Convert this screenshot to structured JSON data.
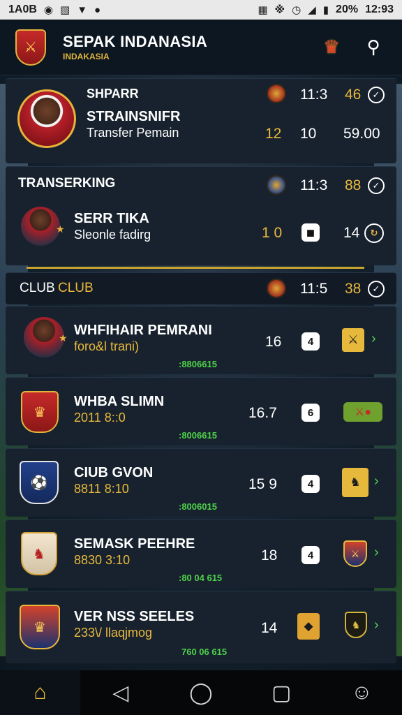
{
  "status_bar": {
    "left_text": "1A0B",
    "percent": "20%",
    "time": "12:93"
  },
  "header": {
    "title": "SEPAK INDANASIA",
    "subtitle": "INDAKASIA"
  },
  "featured": {
    "label": "SHPARR",
    "time": "11:3",
    "score": "46",
    "name": "STRAINSNIFR",
    "sub": "Transfer Pemain",
    "num_a": "12",
    "num_b": "10",
    "num_c": "59.00"
  },
  "transfer_section": {
    "title": "TRANSERKING",
    "time": "11:3",
    "score": "88",
    "player_name": "SERR TIKA",
    "player_sub": "Sleonle fadirg",
    "num_a": "1 0",
    "num_c": "14"
  },
  "club_section": {
    "title_left": "CLUB",
    "title_right": "CLUB",
    "time": "11:5",
    "score": "38"
  },
  "rows": [
    {
      "name": "WHFIHAIR PEMRANI",
      "sub": "foro&l trani)",
      "num": "16",
      "chip": "4",
      "code": ":8806615"
    },
    {
      "name": "WHBA SLIMN",
      "sub": "2011 8::0",
      "num": "16.7",
      "chip": "6",
      "code": ":8006615"
    },
    {
      "name": "CIUB GVON",
      "sub": "8811 8:10",
      "num": "15 9",
      "chip": "4",
      "code": ":8006015"
    },
    {
      "name": "SEMASK PEEHRE",
      "sub": "8830 3:10",
      "num": "18",
      "chip": "4",
      "code": ":80 04 615"
    },
    {
      "name": "VER NSS SEELES",
      "sub": "233\\/ llaqjmog",
      "num": "14",
      "chip": "",
      "code": "760 06 615"
    }
  ],
  "icons": {
    "crown": "crown-icon",
    "search": "search-icon",
    "check": "check-icon",
    "home": "home-icon",
    "back": "back-icon",
    "circle": "home-button-icon",
    "square": "recents-icon",
    "profile": "profile-icon"
  },
  "colors": {
    "accent_gold": "#e9b93c",
    "accent_green": "#4fd14a",
    "panel_bg": "#17222e",
    "header_bg": "#0d1722"
  }
}
